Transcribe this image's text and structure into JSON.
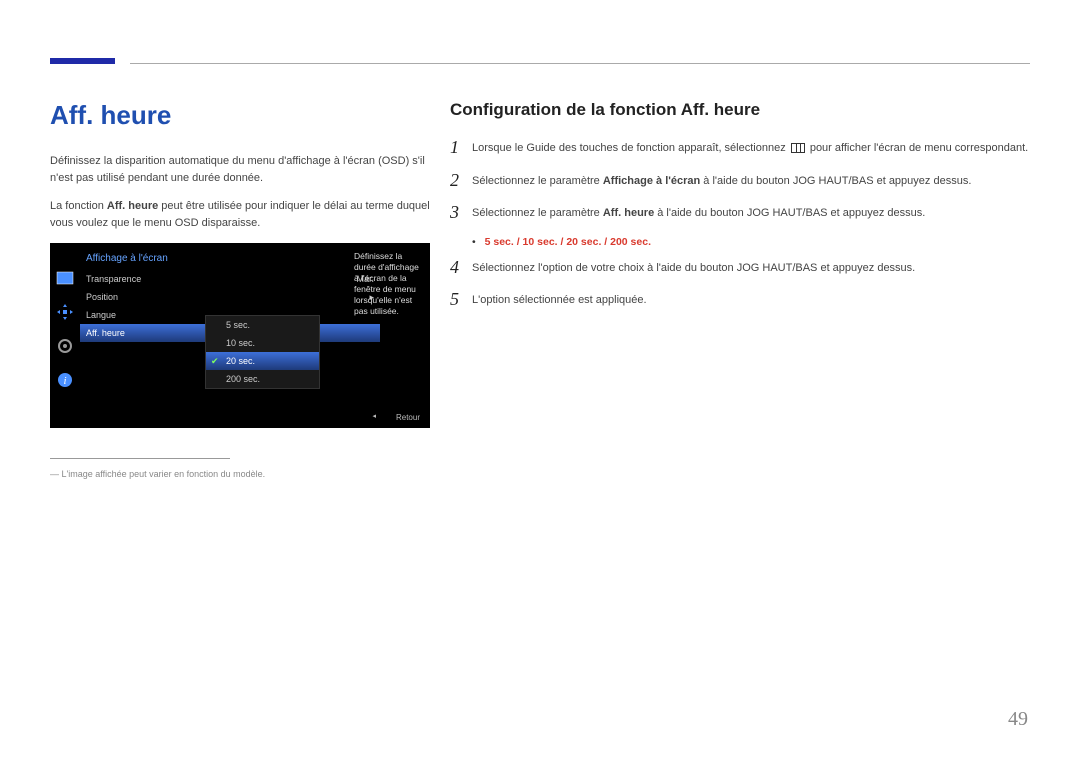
{
  "page_number": "49",
  "left": {
    "title": "Aff. heure",
    "para1": "Définissez la disparition automatique du menu d'affichage à l'écran (OSD) s'il n'est pas utilisé pendant une durée donnée.",
    "para2_pre": "La fonction ",
    "para2_bold": "Aff. heure",
    "para2_post": " peut être utilisée pour indiquer le délai au terme duquel vous voulez que le menu OSD disparaisse.",
    "footnote": "― L'image affichée peut varier en fonction du modèle."
  },
  "osd": {
    "header": "Affichage à l'écran",
    "rows": {
      "transparence": "Transparence",
      "transparence_val": "Mar.",
      "position": "Position",
      "langue": "Langue",
      "affheure": "Aff. heure"
    },
    "popup": [
      "5 sec.",
      "10 sec.",
      "20 sec.",
      "200 sec."
    ],
    "desc": "Définissez la durée d'affichage à l'écran de la fenêtre de menu lorsqu'elle n'est pas utilisée.",
    "retour": "Retour"
  },
  "right": {
    "title": "Configuration de la fonction Aff. heure",
    "steps": {
      "s1_pre": "Lorsque le Guide des touches de fonction apparaît, sélectionnez ",
      "s1_post": " pour afficher l'écran de menu correspondant.",
      "s2_pre": "Sélectionnez le paramètre ",
      "s2_bold": "Affichage à l'écran",
      "s2_post": " à l'aide du bouton JOG HAUT/BAS et appuyez dessus.",
      "s3_pre": "Sélectionnez le paramètre ",
      "s3_bold": "Aff. heure",
      "s3_post": " à l'aide du bouton JOG HAUT/BAS et appuyez dessus.",
      "options": "5 sec. / 10 sec. / 20 sec. / 200 sec.",
      "s4": "Sélectionnez l'option de votre choix à l'aide du bouton JOG HAUT/BAS et appuyez dessus.",
      "s5": "L'option sélectionnée est appliquée."
    }
  }
}
